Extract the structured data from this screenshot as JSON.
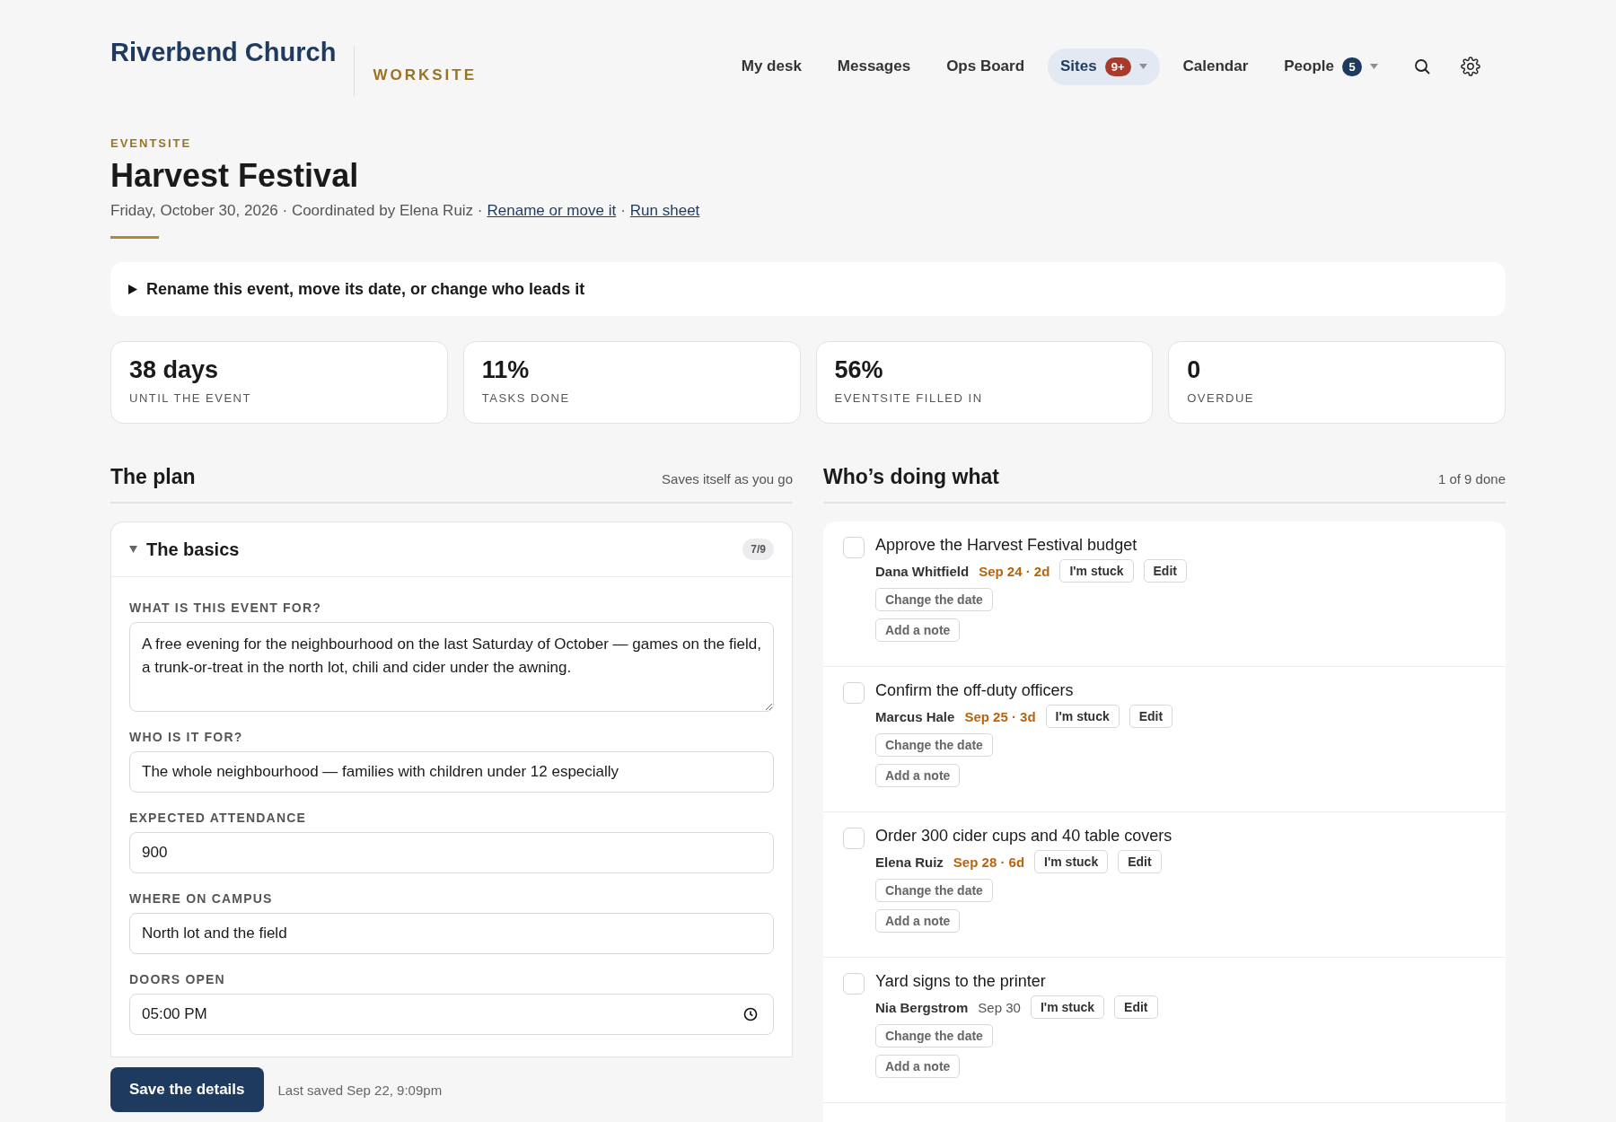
{
  "brand": {
    "name": "Riverbend Church",
    "section": "WORKSITE"
  },
  "nav": [
    {
      "label": "My desk",
      "selected": false,
      "dropdown": false
    },
    {
      "label": "Messages",
      "selected": false,
      "dropdown": false
    },
    {
      "label": "Ops Board",
      "selected": false,
      "dropdown": false
    },
    {
      "label": "Sites",
      "selected": true,
      "dropdown": true,
      "badge": "9+",
      "color": "#a63a2b"
    },
    {
      "label": "Calendar",
      "selected": false,
      "dropdown": false
    },
    {
      "label": "People",
      "selected": false,
      "dropdown": true,
      "badge": "5",
      "color": "#1e3a5f"
    }
  ],
  "page": {
    "eyebrow": "EVENTSITE",
    "title": "Harvest Festival",
    "subtitle": "Friday, October 30, 2026 · Coordinated by Elena Ruiz ·",
    "links": [
      "Rename or move it",
      "Run sheet"
    ],
    "separator": "·"
  },
  "disclosure": {
    "label": "Rename this event, move its date, or change who leads it",
    "expanded": false
  },
  "stats": [
    {
      "value": "38 days",
      "label": "UNTIL THE EVENT"
    },
    {
      "value": "11%",
      "label": "TASKS DONE"
    },
    {
      "value": "56%",
      "label": "EVENTSITE FILLED IN"
    },
    {
      "value": "0",
      "label": "OVERDUE"
    }
  ],
  "plan": {
    "title": "The plan",
    "note": "Saves itself as you go",
    "section": {
      "title": "The basics",
      "expanded": true,
      "count": "7/9"
    },
    "fields": [
      {
        "kind": "textarea",
        "label": "WHAT IS THIS EVENT FOR?",
        "value": "A free evening for the neighbourhood on the last Saturday of October — games on the field, a trunk-or-treat in the north lot, chili and cider under the awning."
      },
      {
        "kind": "text",
        "label": "WHO IS IT FOR?",
        "value": "The whole neighbourhood — families with children under 12 especially"
      },
      {
        "kind": "text",
        "label": "EXPECTED ATTENDANCE",
        "value": "900"
      },
      {
        "kind": "text",
        "label": "WHERE ON CAMPUS",
        "value": "North lot and the field"
      },
      {
        "kind": "time",
        "label": "DOORS OPEN",
        "value": "05:00 PM"
      }
    ],
    "save_button": "Save the details",
    "last_saved": "Last saved Sep 22, 9:09pm"
  },
  "tasks": {
    "title": "Who’s doing what",
    "progress": "1 of 9 done",
    "items": [
      {
        "title": "Approve the Harvest Festival budget",
        "checked": false,
        "owner": "Dana Whitfield",
        "due": "Sep 24 · 2d",
        "due_soon": true,
        "actions": [
          "I'm stuck",
          "Edit"
        ],
        "extra_actions": [
          "Change the date",
          "Add a note"
        ]
      },
      {
        "title": "Confirm the off-duty officers",
        "checked": false,
        "owner": "Marcus Hale",
        "due": "Sep 25 · 3d",
        "due_soon": true,
        "actions": [
          "I'm stuck",
          "Edit"
        ],
        "extra_actions": [
          "Change the date",
          "Add a note"
        ]
      },
      {
        "title": "Order 300 cider cups and 40 table covers",
        "checked": false,
        "owner": "Elena Ruiz",
        "due": "Sep 28 · 6d",
        "due_soon": true,
        "actions": [
          "I'm stuck",
          "Edit"
        ],
        "extra_actions": [
          "Change the date",
          "Add a note"
        ]
      },
      {
        "title": "Yard signs to the printer",
        "checked": false,
        "owner": "Nia Bergstrom",
        "due": "Sep 30",
        "due_soon": false,
        "actions": [
          "I'm stuck",
          "Edit"
        ],
        "extra_actions": [
          "Change the date",
          "Add a note"
        ]
      }
    ]
  }
}
